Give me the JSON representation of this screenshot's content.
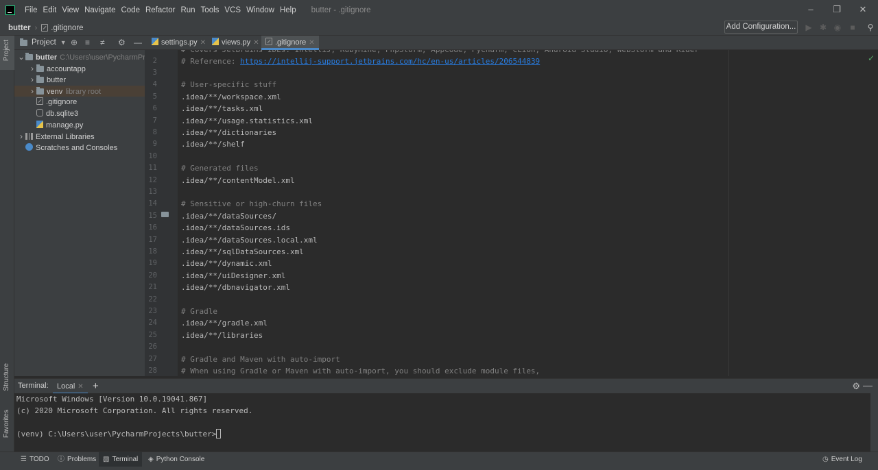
{
  "titlebar": {
    "menus": [
      "File",
      "Edit",
      "View",
      "Navigate",
      "Code",
      "Refactor",
      "Run",
      "Tools",
      "VCS",
      "Window",
      "Help"
    ],
    "window_title": "butter - .gitignore",
    "icons": {
      "minimize": "minimize-icon",
      "restore": "restore-icon",
      "close": "close-icon"
    }
  },
  "navbar": {
    "project": "butter",
    "file": ".gitignore",
    "add_configuration": "Add Configuration..."
  },
  "left_strip": {
    "project_tab": "Project",
    "structure_tab": "Structure",
    "favorites_tab": "Favorites"
  },
  "project_panel": {
    "title": "Project",
    "tree": [
      {
        "label": "butter",
        "hint": "C:\\Users\\user\\PycharmProjects\\butter",
        "type": "folder",
        "expanded": true,
        "depth": 0
      },
      {
        "label": "accountapp",
        "hint": "",
        "type": "folder",
        "expanded": false,
        "depth": 1
      },
      {
        "label": "butter",
        "hint": "",
        "type": "folder",
        "expanded": false,
        "depth": 1
      },
      {
        "label": "venv",
        "hint": "library root",
        "type": "folder",
        "expanded": false,
        "depth": 1
      },
      {
        "label": ".gitignore",
        "hint": "",
        "type": "gitignore",
        "depth": 1
      },
      {
        "label": "db.sqlite3",
        "hint": "",
        "type": "db",
        "depth": 1
      },
      {
        "label": "manage.py",
        "hint": "",
        "type": "py",
        "depth": 1
      },
      {
        "label": "External Libraries",
        "hint": "",
        "type": "lib",
        "expanded": false,
        "depth": 0
      },
      {
        "label": "Scratches and Consoles",
        "hint": "",
        "type": "scratch",
        "depth": 0
      }
    ]
  },
  "editor_tabs": [
    {
      "label": "settings.py",
      "active": false
    },
    {
      "label": "views.py",
      "active": false
    },
    {
      "label": ".gitignore",
      "active": true
    }
  ],
  "editor": {
    "lines": [
      {
        "n": "2",
        "text": "# Reference: ",
        "url": "https://intellij-support.jetbrains.com/hc/en-us/articles/206544839",
        "comment": true
      },
      {
        "n": "3",
        "text": "",
        "comment": false
      },
      {
        "n": "4",
        "text": "# User-specific stuff",
        "comment": true
      },
      {
        "n": "5",
        "text": ".idea/**/workspace.xml",
        "comment": false
      },
      {
        "n": "6",
        "text": ".idea/**/tasks.xml",
        "comment": false
      },
      {
        "n": "7",
        "text": ".idea/**/usage.statistics.xml",
        "comment": false
      },
      {
        "n": "8",
        "text": ".idea/**/dictionaries",
        "comment": false
      },
      {
        "n": "9",
        "text": ".idea/**/shelf",
        "comment": false
      },
      {
        "n": "10",
        "text": "",
        "comment": false
      },
      {
        "n": "11",
        "text": "# Generated files",
        "comment": true
      },
      {
        "n": "12",
        "text": ".idea/**/contentModel.xml",
        "comment": false
      },
      {
        "n": "13",
        "text": "",
        "comment": false
      },
      {
        "n": "14",
        "text": "# Sensitive or high-churn files",
        "comment": true
      },
      {
        "n": "15",
        "text": ".idea/**/dataSources/",
        "comment": false
      },
      {
        "n": "16",
        "text": ".idea/**/dataSources.ids",
        "comment": false
      },
      {
        "n": "17",
        "text": ".idea/**/dataSources.local.xml",
        "comment": false
      },
      {
        "n": "18",
        "text": ".idea/**/sqlDataSources.xml",
        "comment": false
      },
      {
        "n": "19",
        "text": ".idea/**/dynamic.xml",
        "comment": false
      },
      {
        "n": "20",
        "text": ".idea/**/uiDesigner.xml",
        "comment": false
      },
      {
        "n": "21",
        "text": ".idea/**/dbnavigator.xml",
        "comment": false
      },
      {
        "n": "22",
        "text": "",
        "comment": false
      },
      {
        "n": "23",
        "text": "# Gradle",
        "comment": true
      },
      {
        "n": "24",
        "text": ".idea/**/gradle.xml",
        "comment": false
      },
      {
        "n": "25",
        "text": ".idea/**/libraries",
        "comment": false
      },
      {
        "n": "26",
        "text": "",
        "comment": false
      },
      {
        "n": "27",
        "text": "# Gradle and Maven with auto-import",
        "comment": true
      },
      {
        "n": "28",
        "text": "# When using Gradle or Maven with auto-import, you should exclude module files,",
        "comment": true
      }
    ]
  },
  "terminal": {
    "label": "Terminal:",
    "tab": "Local",
    "lines": [
      "Microsoft Windows [Version 10.0.19041.867]",
      "(c) 2020 Microsoft Corporation. All rights reserved.",
      "",
      "(venv) C:\\Users\\user\\PycharmProjects\\butter>"
    ]
  },
  "bottom_bar": {
    "todo": "TODO",
    "problems": "Problems",
    "terminal": "Terminal",
    "python_console": "Python Console",
    "event_log": "Event Log"
  },
  "colors": {
    "accent": "#4a88c7",
    "comment": "#808080",
    "link": "#287bde",
    "ok": "#59a869"
  }
}
